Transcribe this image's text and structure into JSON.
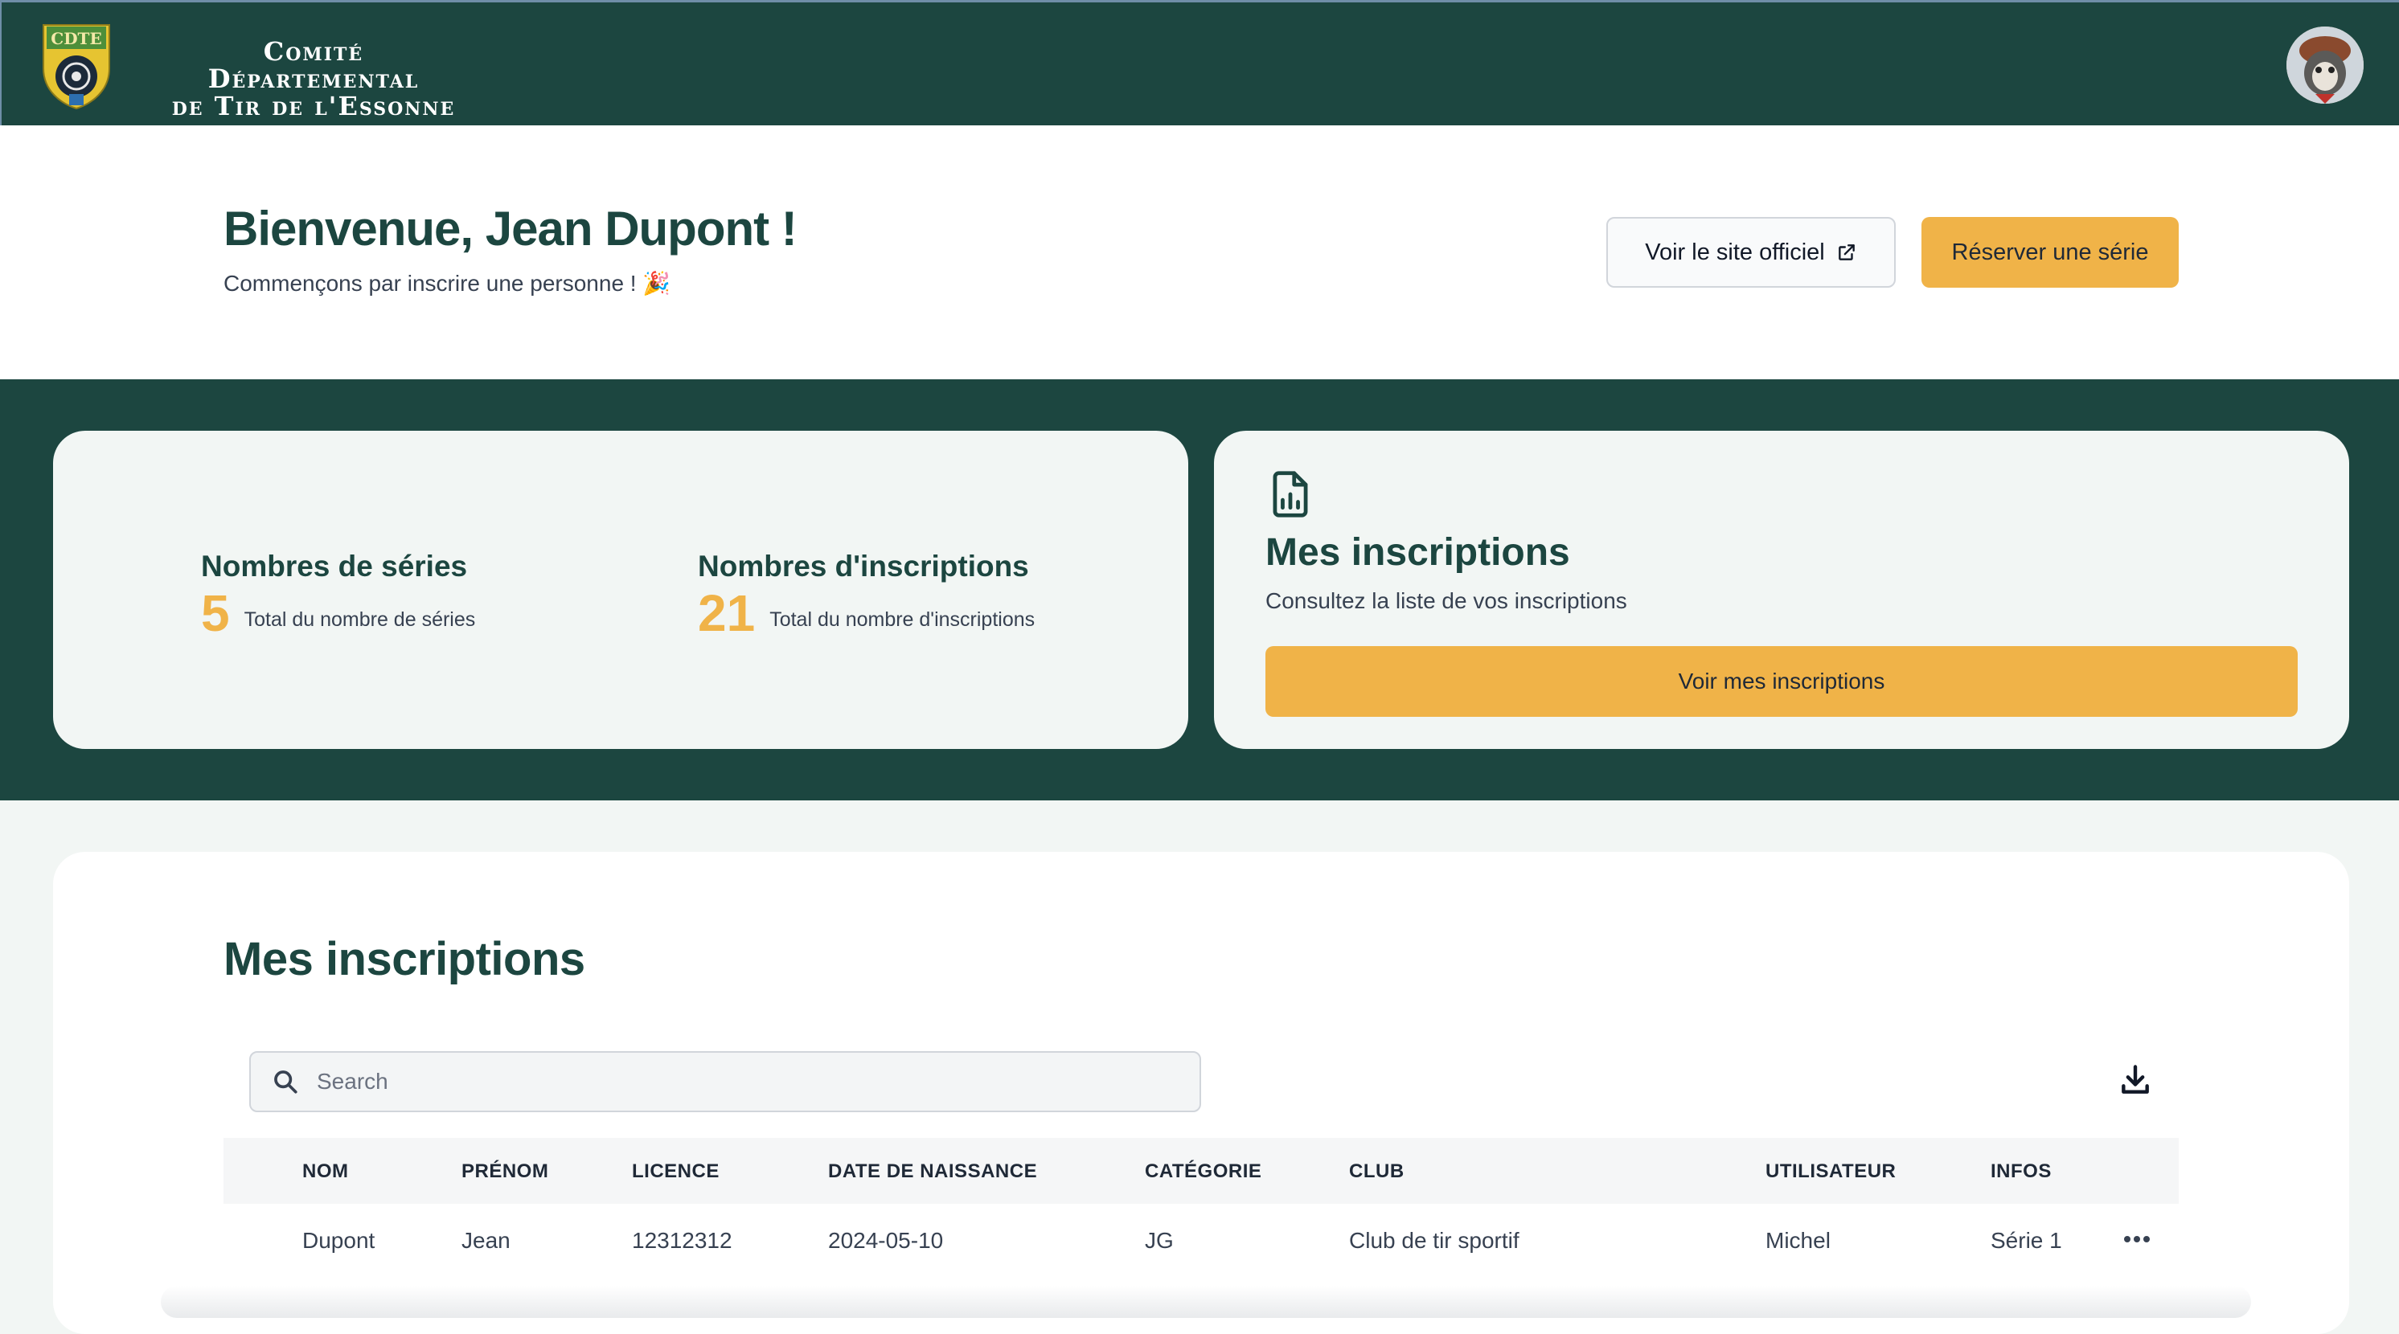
{
  "header": {
    "brand_line1": "Comité Départemental",
    "brand_line2": "de Tir de l'Essonne",
    "logo_text": "CDTE",
    "logo_icon": "crest-logo",
    "avatar_icon": "user-avatar"
  },
  "welcome": {
    "title": "Bienvenue, Jean Dupont !",
    "subtitle": "Commençons par inscrire une personne ! 🎉",
    "site_button": "Voir le site officiel",
    "reserve_button": "Réserver une série"
  },
  "stats": {
    "series_title": "Nombres de séries",
    "series_value": "5",
    "series_label": "Total du nombre de séries",
    "inscriptions_title": "Nombres d'inscriptions",
    "inscriptions_value": "21",
    "inscriptions_label": "Total du nombre d'inscriptions"
  },
  "inscriptions_card": {
    "title": "Mes inscriptions",
    "description": "Consultez la liste de vos inscriptions",
    "button": "Voir mes inscriptions"
  },
  "list": {
    "title": "Mes inscriptions",
    "search_placeholder": "Search",
    "columns": [
      "NOM",
      "PRÉNOM",
      "LICENCE",
      "DATE DE NAISSANCE",
      "CATÉGORIE",
      "CLUB",
      "UTILISATEUR",
      "INFOS"
    ],
    "rows": [
      [
        "Dupont",
        "Jean",
        "12312312",
        "2024-05-10",
        "JG",
        "Club de tir sportif",
        "Michel",
        "Série 1"
      ]
    ]
  },
  "colors": {
    "primary_green": "#1c4640",
    "accent_gold": "#f0b348"
  }
}
